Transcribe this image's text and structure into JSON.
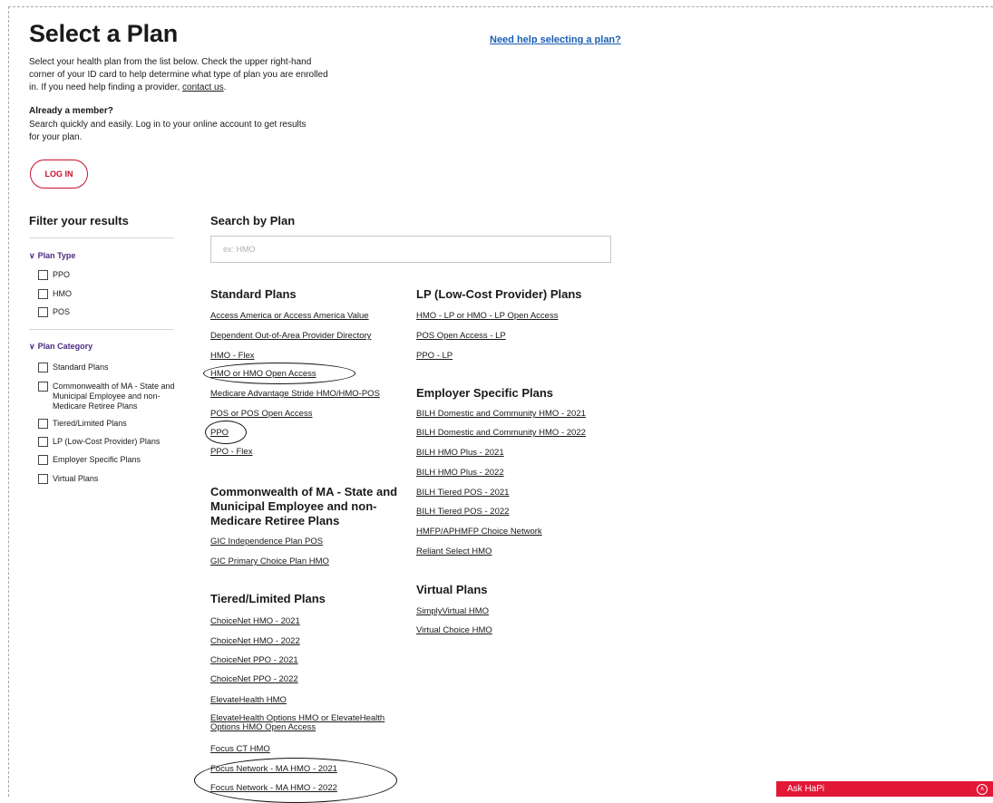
{
  "header": {
    "title": "Select a Plan",
    "help_link": "Need help selecting a plan?"
  },
  "intro": {
    "text_before_link": "Select your health plan from the list below. Check the upper right-hand corner of your ID card to help determine what type of plan you are enrolled in. If you need help finding a provider, ",
    "contact_link": "contact us",
    "text_after_link": "."
  },
  "member": {
    "heading": "Already a member?",
    "text": "Search quickly and easily. Log in to your online account to get results for your plan.",
    "login_label": "LOG IN"
  },
  "filters": {
    "title": "Filter your results",
    "plan_type": {
      "label": "Plan Type",
      "options": [
        "PPO",
        "HMO",
        "POS"
      ]
    },
    "plan_category": {
      "label": "Plan Category",
      "options": [
        "Standard Plans",
        "Commonwealth of MA - State and Municipal Employee and non-Medicare Retiree Plans",
        "Tiered/Limited Plans",
        "LP (Low-Cost Provider) Plans",
        "Employer Specific Plans",
        "Virtual Plans"
      ]
    }
  },
  "search": {
    "heading": "Search by Plan",
    "placeholder": "ex: HMO",
    "value": ""
  },
  "sections": {
    "standard": {
      "heading": "Standard Plans",
      "links": [
        "Access America or Access America Value",
        "Dependent Out-of-Area Provider Directory",
        "HMO - Flex",
        "HMO or HMO Open Access",
        "Medicare Advantage Stride HMO/HMO-POS",
        "POS or POS Open Access",
        "PPO",
        "PPO - Flex"
      ]
    },
    "commonwealth": {
      "heading": "Commonwealth of MA - State and Municipal Employee and non-Medicare Retiree Plans",
      "links": [
        "GIC Independence Plan POS",
        "GIC Primary Choice Plan HMO"
      ]
    },
    "tiered": {
      "heading": "Tiered/Limited Plans",
      "links": [
        "ChoiceNet HMO - 2021",
        "ChoiceNet HMO - 2022",
        "ChoiceNet PPO - 2021",
        "ChoiceNet PPO - 2022",
        "ElevateHealth HMO",
        "ElevateHealth Options HMO or ElevateHealth Options HMO Open Access",
        "Focus CT HMO",
        "Focus Network - MA HMO - 2021",
        "Focus Network - MA HMO - 2022"
      ]
    },
    "lp": {
      "heading": "LP (Low-Cost Provider) Plans",
      "links": [
        "HMO - LP or HMO - LP Open Access",
        "POS Open Access - LP",
        "PPO - LP"
      ]
    },
    "employer": {
      "heading": "Employer Specific Plans",
      "links": [
        "BILH Domestic and Community HMO - 2021",
        "BILH Domestic and Community HMO - 2022",
        "BILH HMO Plus - 2021",
        "BILH HMO Plus - 2022",
        "BILH Tiered POS - 2021",
        "BILH Tiered POS - 2022",
        "HMFP/APHMFP Choice Network",
        "Reliant Select HMO"
      ]
    },
    "virtual": {
      "heading": "Virtual Plans",
      "links": [
        "SimplyVirtual HMO",
        "Virtual Choice HMO"
      ]
    }
  },
  "chat": {
    "label": "Ask HaPi",
    "icon": "chevron-up-circle-icon"
  },
  "colors": {
    "brand_red": "#c8102e",
    "chat_red": "#e31837",
    "filter_purple": "#4b2a83",
    "help_link_blue": "#1a5fb4"
  }
}
